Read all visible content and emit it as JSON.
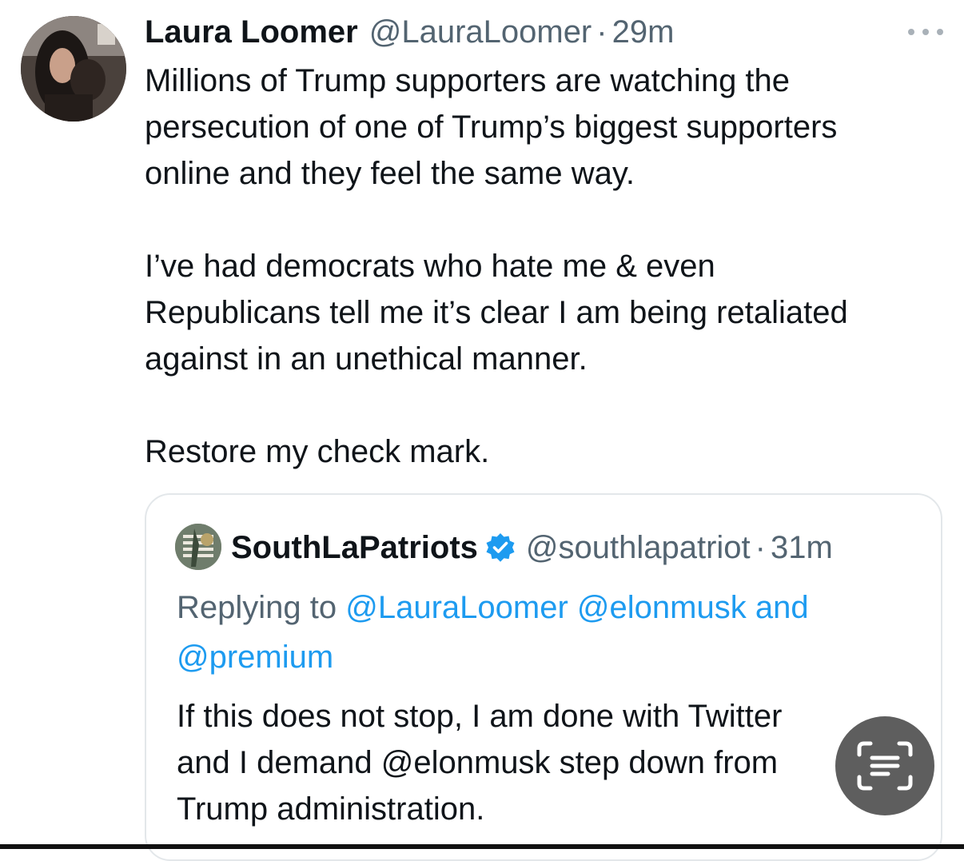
{
  "tweet": {
    "author_name": "Laura Loomer",
    "author_handle": "@LauraLoomer",
    "separator": "·",
    "time": "29m",
    "paragraphs": [
      [
        "Millions of Trump supporters are watching the",
        "persecution of one of Trump’s biggest supporters",
        "online and they feel the same way."
      ],
      [
        "I’ve had democrats who hate me & even",
        "Republicans tell me it’s clear I am being retaliated",
        "against in an unethical manner."
      ],
      [
        "Restore my check mark."
      ]
    ]
  },
  "quoted_tweet": {
    "author_name": "SouthLaPatriots",
    "author_handle": "@southlapatriot",
    "separator": "·",
    "time": "31m",
    "replying_prefix": "Replying to",
    "mention_1": "@LauraLoomer",
    "mention_2": "@elonmusk",
    "and_word": "and",
    "mention_3": "@premium",
    "text_lines": [
      "If this does not stop, I am done with Twitter",
      "and I demand @elonmusk step down from",
      "Trump administration."
    ]
  },
  "colors": {
    "text": "#0f1419",
    "secondary": "#536471",
    "link": "#1d9bf0",
    "verified": "#1d9bf0",
    "card_border": "#e3e7ea"
  },
  "icons": {
    "more": "more-horizontal-icon",
    "verified": "verified-badge-icon",
    "live_text": "live-text-scan-icon"
  }
}
